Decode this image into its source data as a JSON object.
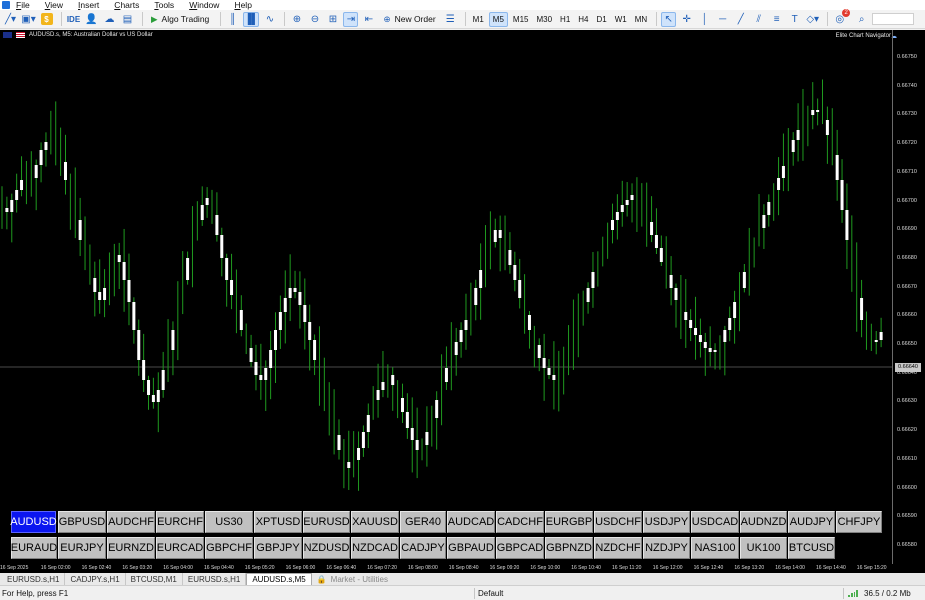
{
  "menu": {
    "items": [
      {
        "label": "File",
        "accel": "F",
        "rest": "ile"
      },
      {
        "label": "View",
        "accel": "V",
        "rest": "iew"
      },
      {
        "label": "Insert",
        "accel": "I",
        "rest": "nsert"
      },
      {
        "label": "Charts",
        "accel": "C",
        "rest": "harts"
      },
      {
        "label": "Tools",
        "accel": "T",
        "rest": "ools"
      },
      {
        "label": "Window",
        "accel": "W",
        "rest": "indow"
      },
      {
        "label": "Help",
        "accel": "H",
        "rest": "elp"
      }
    ]
  },
  "toolbar": {
    "ide_label": "IDE",
    "algo_label": "Algo Trading",
    "new_order_label": "New Order",
    "timeframes": [
      "M1",
      "M5",
      "M15",
      "M30",
      "H1",
      "H4",
      "D1",
      "W1",
      "MN"
    ],
    "active_timeframe": "M5",
    "notification_count": "2"
  },
  "chart": {
    "symbol_title": "AUDUSD.s, M5:  Australian Dollar vs US Dollar",
    "indicator_label": "Elite Chart Navigator",
    "price_levels": [
      "0.66750",
      "0.66740",
      "0.66730",
      "0.66720",
      "0.66710",
      "0.66700",
      "0.66690",
      "0.66680",
      "0.66670",
      "0.66660",
      "0.66650",
      "0.66640",
      "0.66630",
      "0.66620",
      "0.66610",
      "0.66600",
      "0.66590",
      "0.66580"
    ],
    "current_price": "0.66640",
    "time_labels": [
      "16 Sep 2025",
      "16 Sep 02:00",
      "16 Sep 02:40",
      "16 Sep 03:20",
      "16 Sep 04:00",
      "16 Sep 04:40",
      "16 Sep 05:20",
      "16 Sep 06:00",
      "16 Sep 06:40",
      "16 Sep 07:20",
      "16 Sep 08:00",
      "16 Sep 08:40",
      "16 Sep 09:20",
      "16 Sep 10:00",
      "16 Sep 10:40",
      "16 Sep 11:20",
      "16 Sep 12:00",
      "16 Sep 12:40",
      "16 Sep 13:20",
      "16 Sep 14:00",
      "16 Sep 14:40",
      "16 Sep 15:20"
    ],
    "colors": {
      "background": "#000000",
      "bull": "#ffffff",
      "bear": "#ffffff",
      "wick": "#1f9a1f",
      "bid_line": "#4a4a4a"
    }
  },
  "symbols": {
    "row1": [
      "AUDUSD",
      "GBPUSD",
      "AUDCHF",
      "EURCHF",
      "US30",
      "XPTUSD",
      "EURUSD",
      "XAUUSD",
      "GER40",
      "AUDCAD",
      "CADCHF",
      "EURGBP",
      "USDCHF",
      "USDJPY",
      "USDCAD",
      "AUDNZD",
      "AUDJPY",
      "CHFJPY"
    ],
    "row2": [
      "EURAUD",
      "EURJPY",
      "EURNZD",
      "EURCAD",
      "GBPCHF",
      "GBPJPY",
      "NZDUSD",
      "NZDCAD",
      "CADJPY",
      "GBPAUD",
      "GBPCAD",
      "GBPNZD",
      "NZDCHF",
      "NZDJPY",
      "NAS100",
      "UK100",
      "BTCUSD"
    ],
    "selected": "AUDUSD"
  },
  "tabs": {
    "items": [
      "EURUSD.s,H1",
      "CADJPY.s,H1",
      "BTCUSD,M1",
      "EURUSD.s,H1",
      "AUDUSD.s,M5"
    ],
    "active_index": 4,
    "utility_label": "Market - Utilities"
  },
  "status": {
    "help": "For Help, press F1",
    "profile": "Default",
    "traffic": "36.5 / 0.2 Mb"
  }
}
